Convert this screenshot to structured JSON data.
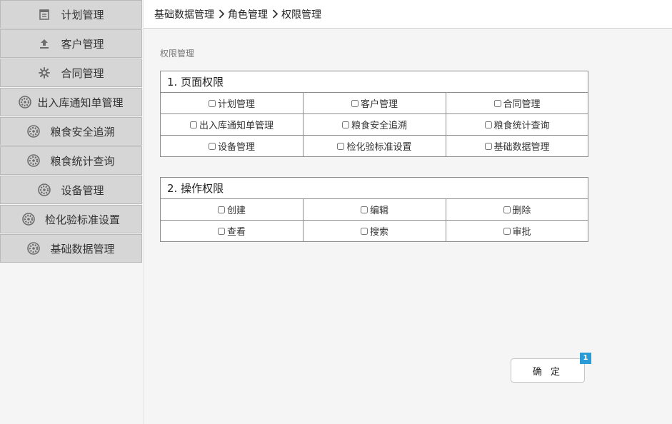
{
  "sidebar": {
    "items": [
      {
        "label": "计划管理",
        "icon": "calendar-icon"
      },
      {
        "label": "客户管理",
        "icon": "upload-icon"
      },
      {
        "label": "合同管理",
        "icon": "gear-icon"
      },
      {
        "label": "出入库通知单管理",
        "icon": "gear-icon"
      },
      {
        "label": "粮食安全追溯",
        "icon": "gear-icon"
      },
      {
        "label": "粮食统计查询",
        "icon": "gear-icon"
      },
      {
        "label": "设备管理",
        "icon": "gear-icon"
      },
      {
        "label": "检化验标准设置",
        "icon": "gear-icon"
      },
      {
        "label": "基础数据管理",
        "icon": "gear-icon"
      }
    ]
  },
  "breadcrumb": {
    "items": [
      "基础数据管理",
      "角色管理",
      "权限管理"
    ],
    "separator_icon": "chevron-right-icon"
  },
  "main": {
    "section_title": "权限管理",
    "page_permissions": {
      "title": "1. 页面权限",
      "rows": [
        [
          "计划管理",
          "客户管理",
          "合同管理"
        ],
        [
          "出入库通知单管理",
          "粮食安全追溯",
          "粮食统计查询"
        ],
        [
          "设备管理",
          "检化验标准设置",
          "基础数据管理"
        ]
      ]
    },
    "operation_permissions": {
      "title": "2. 操作权限",
      "rows": [
        [
          "创建",
          "编辑",
          "删除"
        ],
        [
          "查看",
          "搜索",
          "审批"
        ]
      ]
    },
    "confirm_label": "确 定",
    "badge": "1"
  },
  "colors": {
    "sidebar_item_bg": "#d6d6d6",
    "sidebar_bg": "#f5f5f5",
    "content_bg": "#f5f5f5",
    "badge_bg": "#2a9bd6"
  }
}
